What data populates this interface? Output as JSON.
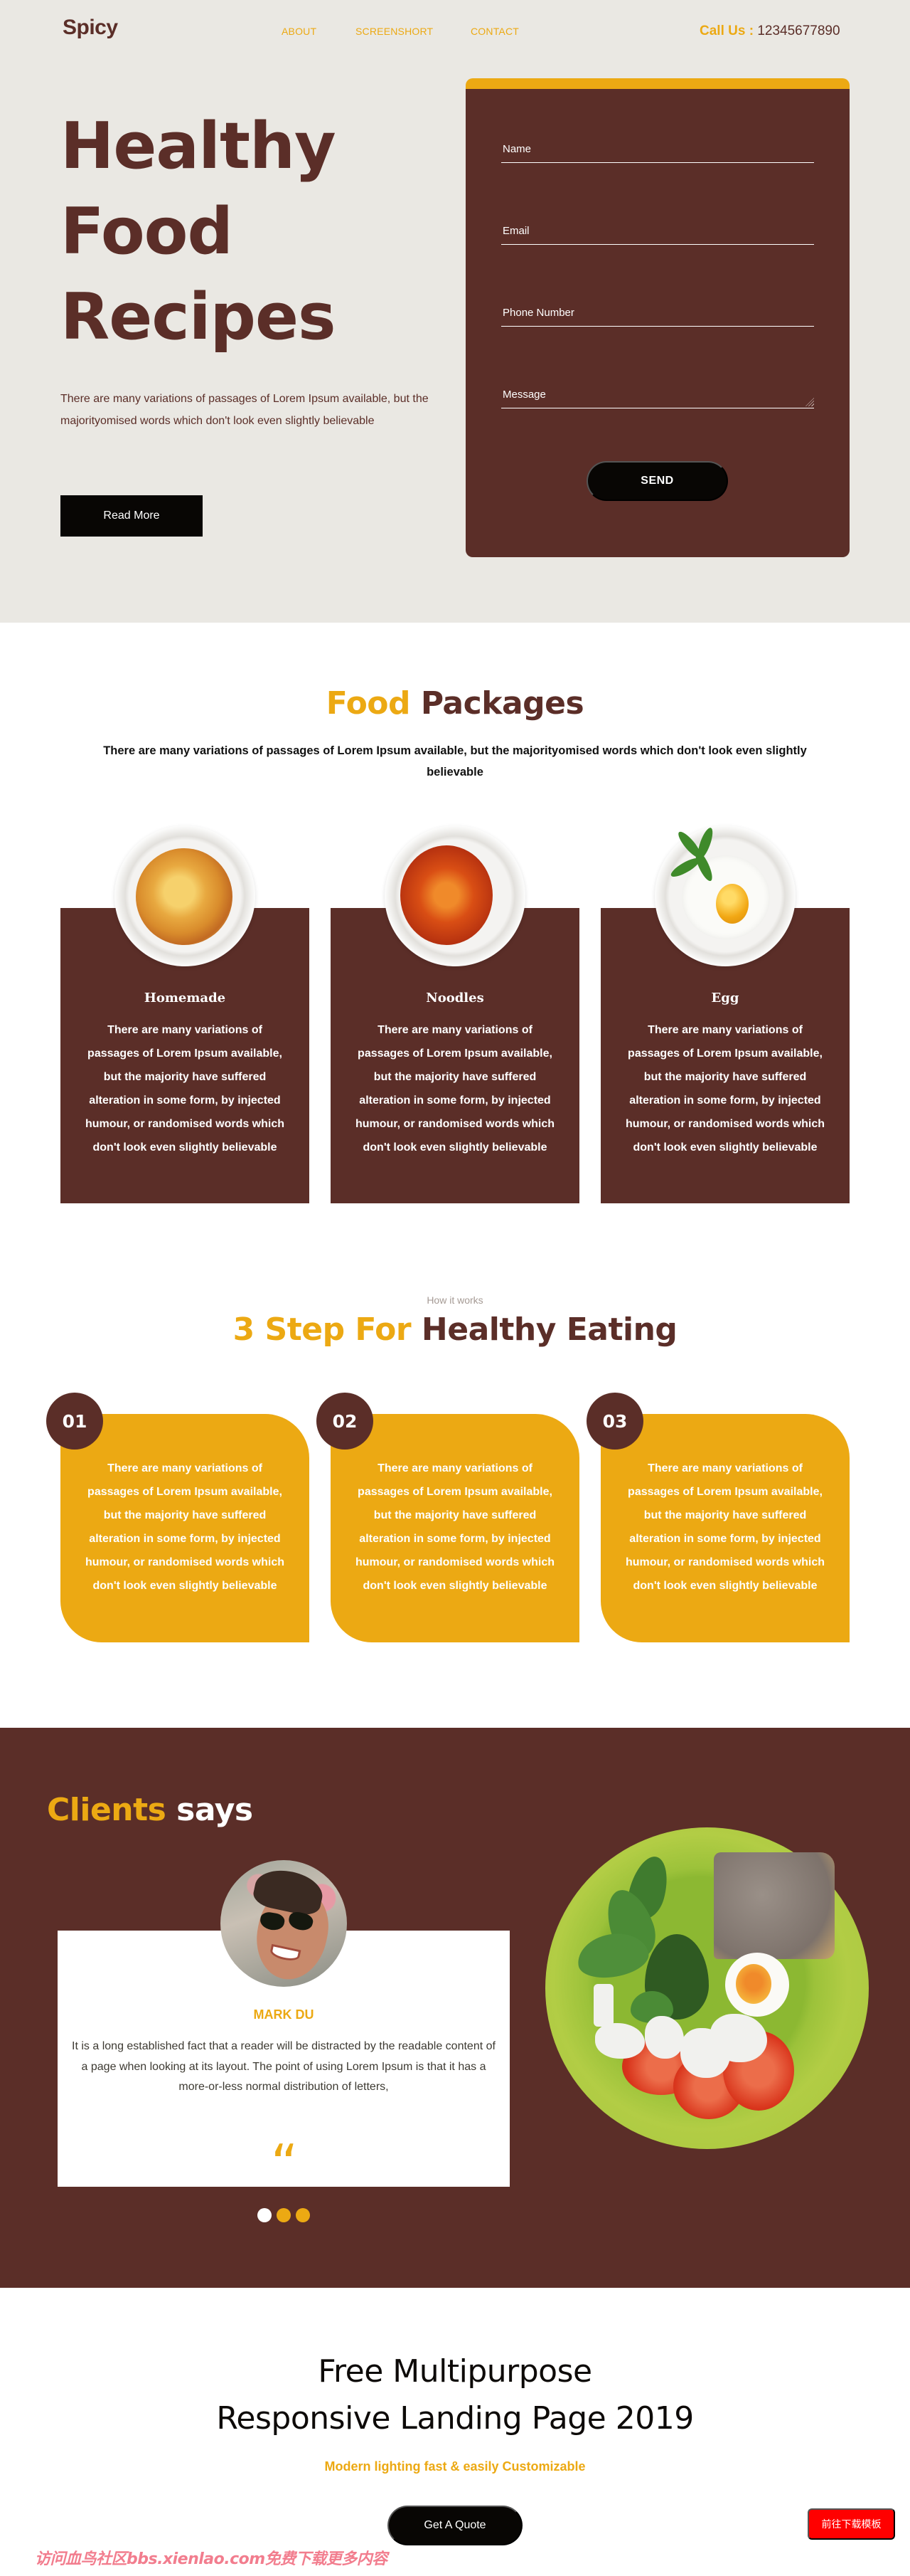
{
  "colors": {
    "brown": "#5B2E28",
    "yellow": "#ECA913",
    "beige": "#EAE8E3",
    "black": "#080604",
    "red": "#FF0000"
  },
  "header": {
    "logo": "Spicy",
    "nav": [
      "ABOUT",
      "SCREENSHORT",
      "CONTACT"
    ],
    "call_label": "Call Us :",
    "call_number": "12345677890"
  },
  "hero": {
    "title_lines": [
      "Healthy",
      "Food",
      "Recipes"
    ],
    "text": "There are many variations of passages of Lorem Ipsum available, but the majorityomised words which don't look even slightly believable",
    "read_more": "Read More"
  },
  "contact_form": {
    "fields": [
      {
        "placeholder": "Name",
        "value": ""
      },
      {
        "placeholder": "Email",
        "value": ""
      },
      {
        "placeholder": "Phone Number",
        "value": ""
      },
      {
        "placeholder": "Message",
        "value": ""
      }
    ],
    "send": "SEND"
  },
  "packages": {
    "title_highlight": "Food",
    "title_rest": "Packages",
    "subtitle": "There are many variations of passages of Lorem Ipsum available, but the majorityomised words which don't look even slightly believable",
    "items": [
      {
        "title": "Homemade",
        "image": "spaghetti-plate",
        "text": "There are many variations of passages of Lorem Ipsum available, but the majority have suffered alteration in some form, by injected humour, or randomised words which don't look even slightly believable"
      },
      {
        "title": "Noodles",
        "image": "soup-plate",
        "text": "There are many variations of passages of Lorem Ipsum available, but the majority have suffered alteration in some form, by injected humour, or randomised words which don't look even slightly believable"
      },
      {
        "title": "Egg",
        "image": "fried-egg-plate",
        "text": "There are many variations of passages of Lorem Ipsum available, but the majority have suffered alteration in some form, by injected humour, or randomised words which don't look even slightly believable"
      }
    ]
  },
  "steps": {
    "kicker": "How it works",
    "title_highlight": "3 Step For",
    "title_rest": "Healthy Eating",
    "items": [
      {
        "number": "01",
        "text": "There are many variations of passages of Lorem Ipsum available, but the majority have suffered alteration in some form, by injected humour, or randomised words which don't look even slightly believable"
      },
      {
        "number": "02",
        "text": "There are many variations of passages of Lorem Ipsum available, but the majority have suffered alteration in some form, by injected humour, or randomised words which don't look even slightly believable"
      },
      {
        "number": "03",
        "text": "There are many variations of passages of Lorem Ipsum available, but the majority have suffered alteration in some form, by injected humour, or randomised words which don't look even slightly believable"
      }
    ]
  },
  "clients": {
    "title_highlight": "Clients",
    "title_rest": "says",
    "testimonial": {
      "name": "MARK DU",
      "text": "It is a long established fact that a reader will be distracted by the readable content of a page when looking at its layout. The point of using Lorem Ipsum is that it has a more-or-less normal distribution of letters,",
      "quote_glyph": "“"
    },
    "slider_dots": 3,
    "active_dot": 0
  },
  "cta": {
    "title_line1": "Free Multipurpose",
    "title_line2": "Responsive Landing Page 2019",
    "subtitle": "Modern lighting fast & easily Customizable",
    "button": "Get A Quote"
  },
  "overlay": {
    "download_button": "前往下载模板",
    "watermark": "访问血鸟社区bbs.xienlao.com免费下载更多内容"
  }
}
